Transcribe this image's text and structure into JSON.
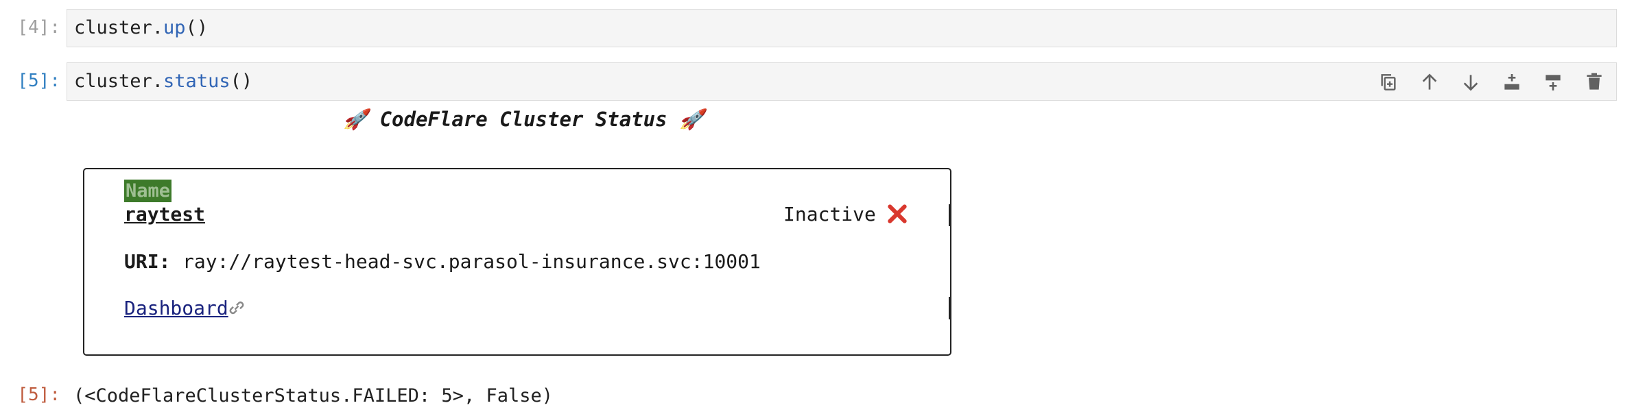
{
  "cells": [
    {
      "prompt": "[4]:",
      "code_obj": "cluster.",
      "code_fn": "up",
      "code_args": "()"
    },
    {
      "prompt": "[5]:",
      "code_obj": "cluster.",
      "code_fn": "status",
      "code_args": "()"
    }
  ],
  "toolbar": {
    "buttons": [
      "duplicate-icon",
      "move-up-icon",
      "move-down-icon",
      "insert-above-icon",
      "insert-below-icon",
      "delete-icon"
    ]
  },
  "status_widget": {
    "title": "🚀 CodeFlare Cluster Status 🚀",
    "name_header": "Name",
    "cluster_name": "raytest",
    "status": "Inactive",
    "status_icon": "red-x-icon",
    "uri_label": "URI:",
    "uri_value": "ray://raytest-head-svc.parasol-insurance.svc:10001",
    "dashboard_label": "Dashboard",
    "dashboard_icon": "link-icon"
  },
  "output": {
    "prompt": "[5]:",
    "text": "(<CodeFlareClusterStatus.FAILED: 5>, False)"
  },
  "colors": {
    "prompt_idle": "#9e9e9e",
    "prompt_active": "#307fc1",
    "prompt_out": "#bf5b3d",
    "function": "#3165b5",
    "name_highlight": "#3d7a2a",
    "x_red": "#d9382e",
    "link": "#1a237e"
  }
}
